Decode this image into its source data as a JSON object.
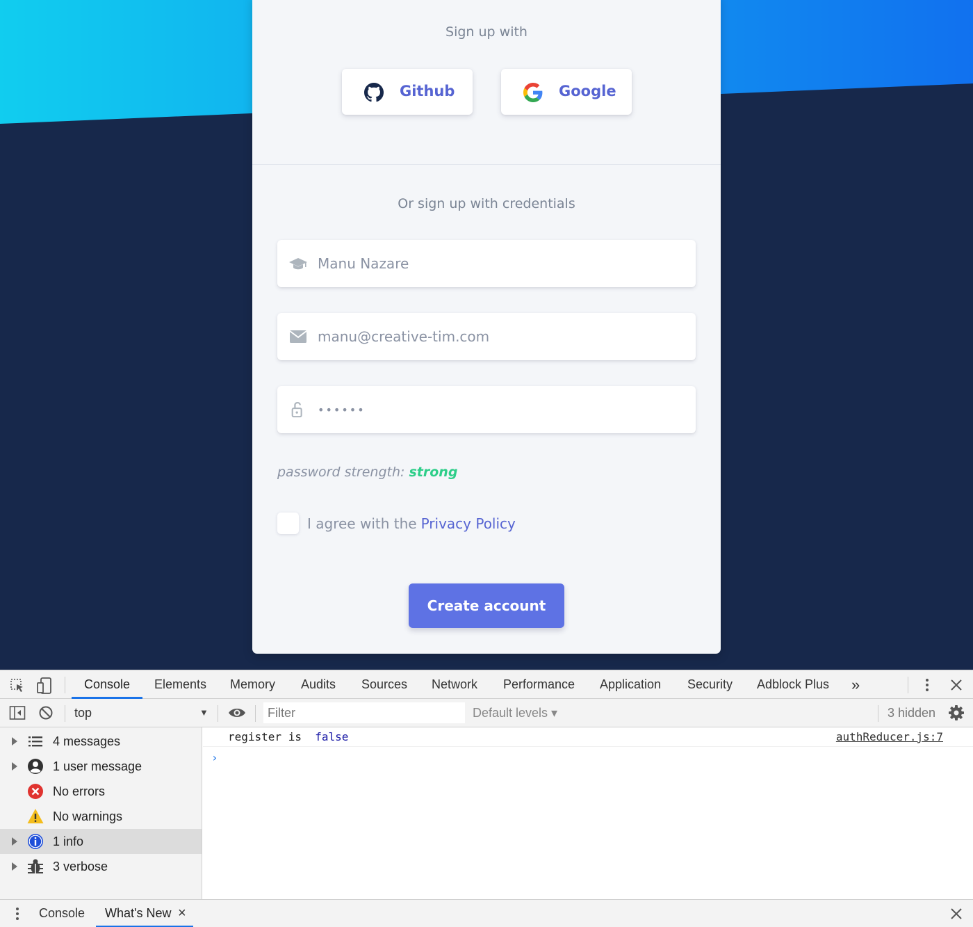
{
  "signup": {
    "social_heading": "Sign up with",
    "github_label": "Github",
    "google_label": "Google",
    "credentials_heading": "Or sign up with credentials",
    "name_value": "Manu Nazare",
    "email_value": "manu@creative-tim.com",
    "password_value": "••••••",
    "strength_label": "password strength:",
    "strength_value": "strong",
    "agree_text": "I agree with the",
    "privacy_link": "Privacy Policy",
    "create_button": "Create account"
  },
  "devtools": {
    "tabs": [
      "Console",
      "Elements",
      "Memory",
      "Audits",
      "Sources",
      "Network",
      "Performance",
      "Application",
      "Security",
      "Adblock Plus"
    ],
    "more_tabs": "»",
    "context": "top",
    "filter_placeholder": "Filter",
    "levels": "Default levels ▾",
    "hidden": "3 hidden",
    "sidebar": [
      {
        "label": "4 messages"
      },
      {
        "label": "1 user message"
      },
      {
        "label": "No errors"
      },
      {
        "label": "No warnings"
      },
      {
        "label": "1 info"
      },
      {
        "label": "3 verbose"
      }
    ],
    "log": {
      "message": "register is ",
      "value": "false",
      "source": "authReducer.js:7"
    },
    "prompt": "›",
    "drawer_tabs": [
      "Console",
      "What's New"
    ],
    "drawer_close": "×"
  },
  "colors": {
    "accent": "#5e72e4",
    "link": "#5664d2",
    "strong": "#2dce89",
    "page_bg": "#17284b",
    "devtools_blue": "#1a73e8"
  }
}
